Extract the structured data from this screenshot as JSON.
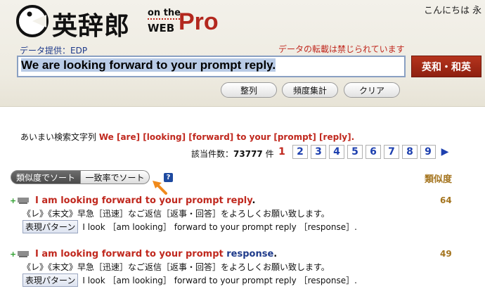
{
  "header": {
    "logo_title": "英辞郎",
    "logo_onthe": "on the",
    "logo_web": "WEB",
    "logo_pro": "Pro",
    "greeting": "こんにちは 永",
    "provider": "データ提供：EDP",
    "notice": "データの転載は禁じられています"
  },
  "search": {
    "value": "We are looking forward to your prompt reply.",
    "button": "英和・和英"
  },
  "toolbar": {
    "sort_label": "整列",
    "freq_label": "頻度集計",
    "clear_label": "クリア"
  },
  "fuzzy": {
    "label": "あいまい検索文字列",
    "query": "We [are] [looking] [forward] to your [prompt] [reply]."
  },
  "count": {
    "label": "該当件数：",
    "value": "73777",
    "unit": "件"
  },
  "pager": {
    "current": "1",
    "pages": [
      "2",
      "3",
      "4",
      "5",
      "6",
      "7",
      "8",
      "9"
    ],
    "next": "▶"
  },
  "sort": {
    "similarity": "類似度でソート",
    "match": "一致率でソート",
    "help": "?"
  },
  "similarity_header": "類似度",
  "results": [
    {
      "title_red": "I am looking forward to your prompt reply",
      "title_blue": "",
      "period": ".",
      "score": "64",
      "translation": "《レ》《末文》早急［迅速］なご返信［返事・回答］をよろしくお願い致します。",
      "pattern_button": "表現パターン",
      "pattern": "I look ［am looking］ forward to your prompt reply ［response］."
    },
    {
      "title_red": "I am looking forward to your prompt",
      "title_blue": " response",
      "period": ".",
      "score": "49",
      "translation": "《レ》《末文》早急［迅速］なご返信［返事・回答］をよろしくお願い致します。",
      "pattern_button": "表現パターン",
      "pattern": "I look ［am looking］ forward to your prompt reply ［response］."
    }
  ],
  "colors": {
    "brand_red": "#b3281e",
    "link_blue": "#1e40af",
    "score_gold": "#a4741e"
  }
}
